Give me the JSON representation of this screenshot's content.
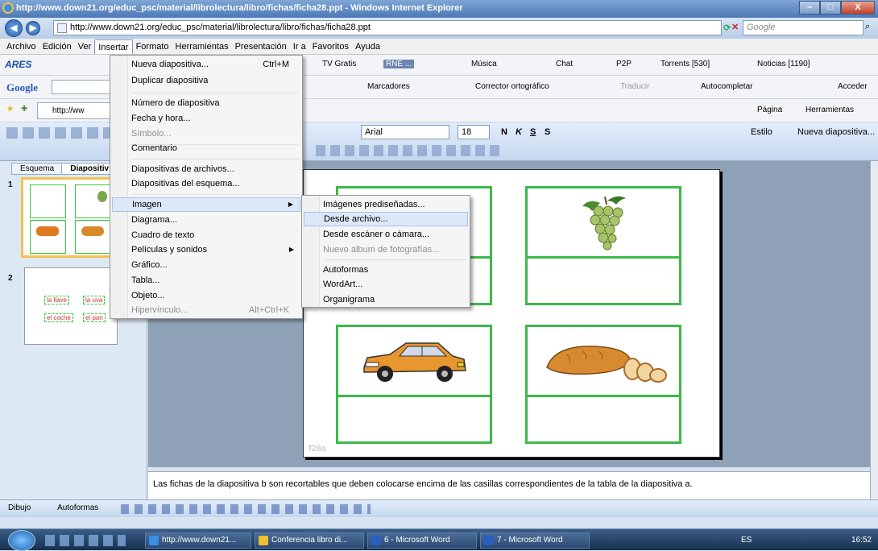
{
  "window": {
    "title": "http://www.down21.org/educ_psc/material/librolectura/libro/fichas/ficha28.ppt - Windows Internet Explorer",
    "address": "http://www.down21.org/educ_psc/material/librolectura/libro/fichas/ficha28.ppt",
    "search_placeholder": "Google",
    "min": "–",
    "max": "□",
    "close": "X"
  },
  "menubar": [
    "Archivo",
    "Edición",
    "Ver",
    "Insertar",
    "Formato",
    "Herramientas",
    "Presentación",
    "Ir a",
    "Favoritos",
    "Ayuda"
  ],
  "ares_bar": {
    "brand": "ARES",
    "items": [
      "TV Gratis",
      "RNE ...",
      "Música",
      "Chat",
      "P2P",
      "Torrents [530]",
      "Noticias [1190]"
    ]
  },
  "google_bar": {
    "brand": "Google",
    "items": [
      "Marcadores",
      "Corrector ortográfico",
      "Traducir",
      "Autocompletar",
      "Acceder"
    ]
  },
  "ie_cmdbar": {
    "tab_title": "http://ww",
    "items": [
      "Página",
      "Herramientas"
    ]
  },
  "ppt_toolbar": {
    "font": "Arial",
    "size": "18",
    "buttons": [
      "N",
      "K",
      "S",
      "S"
    ],
    "estilo": "Estilo",
    "nueva": "Nueva diapositiva..."
  },
  "insert_menu": [
    {
      "label": "Nueva diapositiva...",
      "shortcut": "Ctrl+M"
    },
    {
      "label": "Duplicar diapositiva"
    },
    {
      "label": "Número de diapositiva"
    },
    {
      "label": "Fecha y hora..."
    },
    {
      "label": "Símbolo..."
    },
    {
      "label": "Comentario"
    },
    {
      "label": "Diapositivas de archivos..."
    },
    {
      "label": "Diapositivas del esquema..."
    },
    {
      "label": "Imagen"
    },
    {
      "label": "Diagrama..."
    },
    {
      "label": "Cuadro de texto"
    },
    {
      "label": "Películas y sonidos"
    },
    {
      "label": "Gráfico..."
    },
    {
      "label": "Tabla..."
    },
    {
      "label": "Objeto..."
    },
    {
      "label": "Hipervínculo...",
      "shortcut": "Alt+Ctrl+K"
    }
  ],
  "image_submenu": [
    {
      "label": "Imágenes prediseñadas..."
    },
    {
      "label": "Desde archivo..."
    },
    {
      "label": "Desde escáner o cámara..."
    },
    {
      "label": "Nuevo álbum de fotografías..."
    },
    {
      "label": "Autoformas"
    },
    {
      "label": "WordArt..."
    },
    {
      "label": "Organigrama"
    }
  ],
  "left_panel": {
    "tabs": [
      "Esquema",
      "Diapositiv"
    ],
    "slide_numbers": [
      "1",
      "2"
    ],
    "chips": [
      "la llave",
      "la uva",
      "el coche",
      "el pan"
    ]
  },
  "slide": {
    "footer_text": "f28a"
  },
  "notes": "Las fichas de la diapositiva b son recortables que deben colocarse encima de las casillas correspondientes de la tabla de la diapositiva a.",
  "drawbar": {
    "dibujo": "Dibujo",
    "autoformas": "Autoformas"
  },
  "taskbar": {
    "tasks": [
      "http://www.down21...",
      "Conferencia libro di...",
      "6 - Microsoft Word",
      "7 - Microsoft Word"
    ],
    "lang": "ES",
    "time": "16:52"
  }
}
